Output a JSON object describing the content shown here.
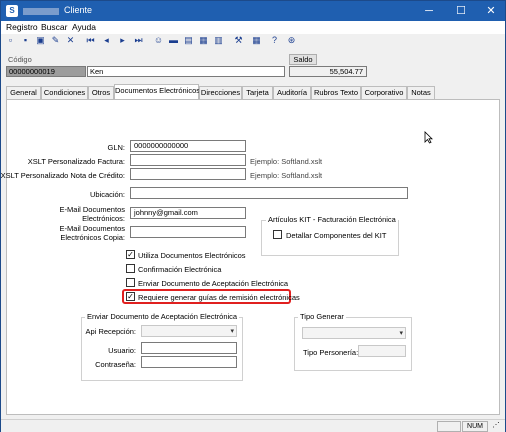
{
  "window": {
    "title": "Cliente",
    "controls": {
      "minimize": "─",
      "maximize": "☐",
      "close": "✕"
    }
  },
  "menu": [
    "Registro",
    "Buscar",
    "Ayuda"
  ],
  "header": {
    "codigo_label": "Código",
    "codigo_value": "00000000019",
    "nombre_value": "Ken",
    "saldo_button": "Saldo",
    "saldo_value": "55,504.77"
  },
  "tabs": [
    "General",
    "Condiciones",
    "Otros",
    "Documentos Electrónicos",
    "Direcciones",
    "Tarjeta",
    "Auditoría",
    "Rubros Texto",
    "Corporativo",
    "Notas"
  ],
  "form": {
    "gln_label": "GLN:",
    "gln_value": "0000000000000",
    "xslt_factura_label": "XSLT Personalizado Factura:",
    "xslt_factura_value": "",
    "xslt_factura_hint": "Ejemplo: Softland.xslt",
    "xslt_nota_label": "XSLT Personalizado Nota de Crédito:",
    "xslt_nota_value": "",
    "xslt_nota_hint": "Ejemplo: Softland.xslt",
    "ubicacion_label": "Ubicación:",
    "ubicacion_value": "",
    "email_label_1": "E-Mail Documentos",
    "email_label_2": "Electrónicos:",
    "email_value": "johnny@gmail.com",
    "email_copia_label_1": "E-Mail Documentos",
    "email_copia_label_2": "Electrónicos Copia:",
    "email_copia_value": ""
  },
  "kit_group": {
    "title": "Artículos KIT - Facturación Electrónica",
    "detallar_label": "Detallar Componentes del KIT",
    "detallar_checked": false
  },
  "checkboxes": [
    {
      "label": "Utiliza Documentos Electrónicos",
      "checked": true
    },
    {
      "label": "Confirmación Electrónica",
      "checked": false
    },
    {
      "label": "Enviar Documento de Aceptación Electrónica",
      "checked": false
    },
    {
      "label": "Requiere generar guías de remisión electrónicas",
      "checked": true
    }
  ],
  "aceptacion_group": {
    "title": "Enviar Documento de Aceptación Electrónica",
    "api_label": "Api Recepción:",
    "api_value": "",
    "usuario_label": "Usuario:",
    "usuario_value": "",
    "contrasena_label": "Contraseña:",
    "contrasena_value": ""
  },
  "tipo_group": {
    "title": "Tipo Generar",
    "tipo_value": "",
    "personeria_label": "Tipo Personería:",
    "personeria_value": ""
  },
  "status": {
    "num": "NUM"
  },
  "colors": {
    "titlebar": "#1f5fb0",
    "highlight": "#e0201f",
    "panel": "#ffffff"
  }
}
